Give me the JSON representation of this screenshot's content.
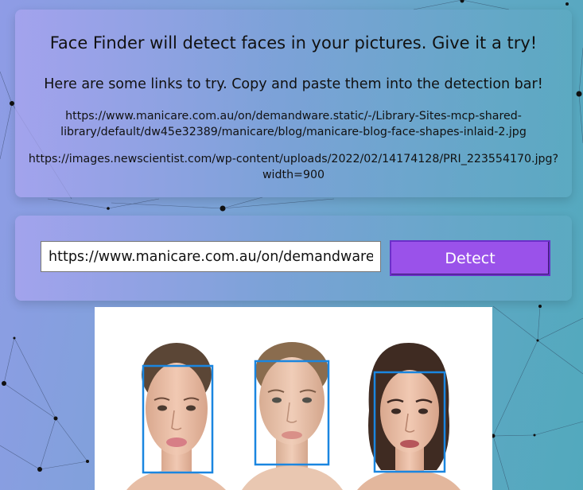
{
  "info": {
    "title": "Face Finder will detect faces in your pictures. Give it a try!",
    "subtitle": "Here are some links to try. Copy and paste them into the detection bar!",
    "links": [
      "https://www.manicare.com.au/on/demandware.static/-/Library-Sites-mcp-shared-library/default/dw45e32389/manicare/blog/manicare-blog-face-shapes-inlaid-2.jpg",
      "https://images.newscientist.com/wp-content/uploads/2022/02/14174128/PRI_223554170.jpg?width=900"
    ]
  },
  "detect": {
    "input_value": "https://www.manicare.com.au/on/demandware.static/-/Library-Sites-mcp-shared-library/default/dw45e32389/manicare/blog/manicare-blog-face-shapes-inlaid-2.jpg",
    "button_label": "Detect"
  },
  "result": {
    "faces_detected": 3,
    "box_color": "#1a86e0"
  },
  "colors": {
    "button": "#9a52ea",
    "background_start": "#8f9ce6",
    "background_end": "#52a9bd"
  }
}
